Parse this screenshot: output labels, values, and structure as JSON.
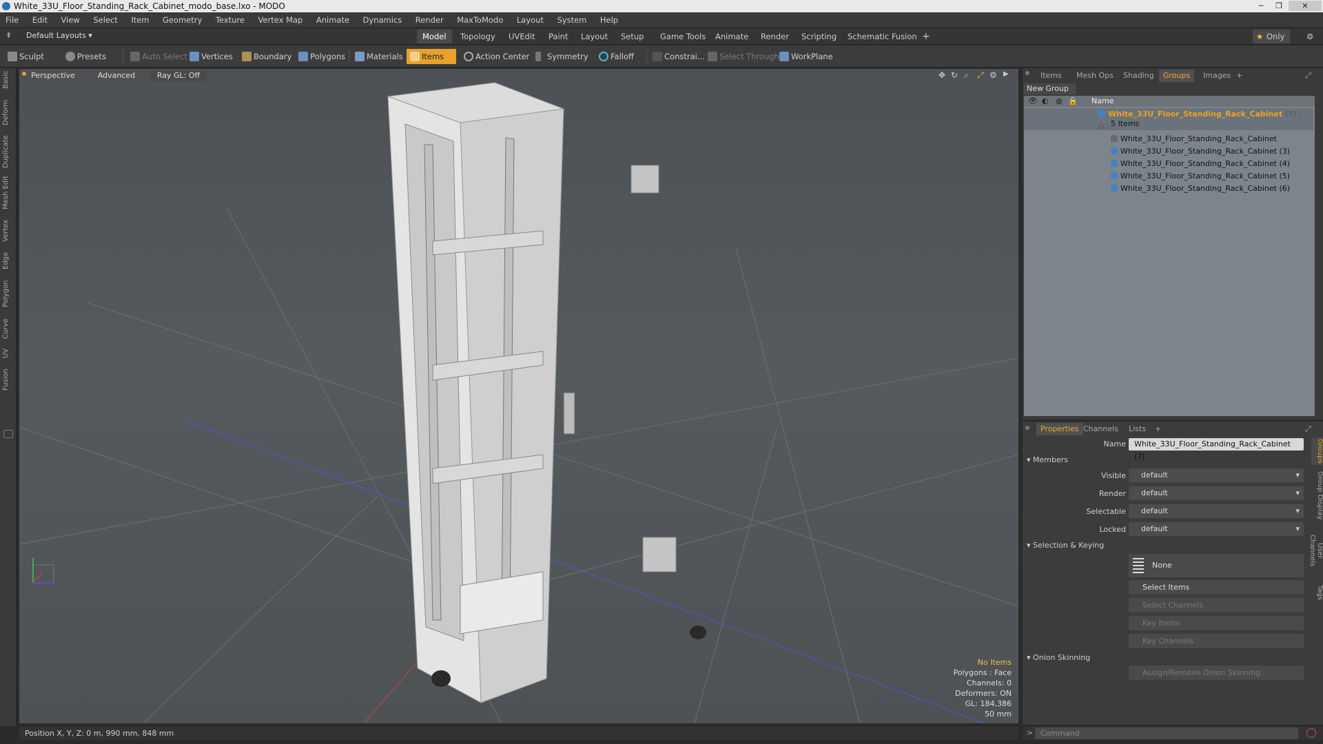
{
  "window": {
    "title": "White_33U_Floor_Standing_Rack_Cabinet_modo_base.lxo - MODO"
  },
  "menu": [
    "File",
    "Edit",
    "View",
    "Select",
    "Item",
    "Geometry",
    "Texture",
    "Vertex Map",
    "Animate",
    "Dynamics",
    "Render",
    "MaxToModo",
    "Layout",
    "System",
    "Help"
  ],
  "layout_selector": "Default Layouts ▾",
  "layout_tabs": [
    "Model",
    "Topology",
    "UVEdit",
    "Paint",
    "Layout",
    "Setup",
    "Game Tools",
    "Animate",
    "Render",
    "Scripting",
    "Schematic Fusion"
  ],
  "active_layout_tab": "Model",
  "only_label": "Only",
  "toolbar": {
    "sculpt": "Sculpt",
    "presets": "Presets",
    "auto_select": "Auto Select",
    "vertices": "Vertices",
    "boundary": "Boundary",
    "polygons": "Polygons",
    "materials": "Materials",
    "items": "Items",
    "action_center": "Action Center",
    "symmetry": "Symmetry",
    "falloff": "Falloff",
    "constraints": "Constrai...",
    "select_through": "Select Through",
    "workplane": "WorkPlane"
  },
  "left_tabs": [
    "Basic",
    "Deform",
    "Duplicate",
    "Mesh Edit",
    "Vertex",
    "Edge",
    "Polygon",
    "Curve",
    "UV",
    "Fusion"
  ],
  "viewport": {
    "view_label": "Perspective",
    "shading_label": "Advanced",
    "raygl_label": "Ray GL: Off",
    "info": {
      "items": "No Items",
      "polygons": "Polygons : Face",
      "channels": "Channels: 0",
      "deformers": "Deformers: ON",
      "gl": "GL: 184,386",
      "distance": "50 mm"
    }
  },
  "status": {
    "position": "Position X, Y, Z:  0 m, 990 mm, 848 mm"
  },
  "groups_panel": {
    "tabs": [
      "Items",
      "Mesh Ops",
      "Shading",
      "Groups",
      "Images"
    ],
    "active_tab": "Groups",
    "new_group": "New Group",
    "name_header": "Name",
    "group_name": "White_33U_Floor_Standing_Rack_Cabinet",
    "group_suffix": "(7) : G...",
    "group_count": "5 Items",
    "children": [
      "White_33U_Floor_Standing_Rack_Cabinet",
      "White_33U_Floor_Standing_Rack_Cabinet (3)",
      "White_33U_Floor_Standing_Rack_Cabinet (4)",
      "White_33U_Floor_Standing_Rack_Cabinet (5)",
      "White_33U_Floor_Standing_Rack_Cabinet (6)"
    ]
  },
  "properties": {
    "tabs": [
      "Properties",
      "Channels",
      "Lists"
    ],
    "name_label": "Name",
    "name_value": "White_33U_Floor_Standing_Rack_Cabinet (7)",
    "members_section": "Members",
    "visible_label": "Visible",
    "visible_value": "default",
    "render_label": "Render",
    "render_value": "default",
    "selectable_label": "Selectable",
    "selectable_value": "default",
    "locked_label": "Locked",
    "locked_value": "default",
    "selection_section": "Selection & Keying",
    "none_label": "None",
    "select_items": "Select Items",
    "select_channels": "Select Channels",
    "key_items": "Key Items",
    "key_channels": "Key Channels",
    "onion_section": "Onion Skinning",
    "onion_button": "Assign/Remove Onion Skinning",
    "side_tabs": [
      "Groups",
      "Group Display",
      "User Channels",
      "Tags"
    ]
  },
  "command": {
    "placeholder": "Command"
  }
}
